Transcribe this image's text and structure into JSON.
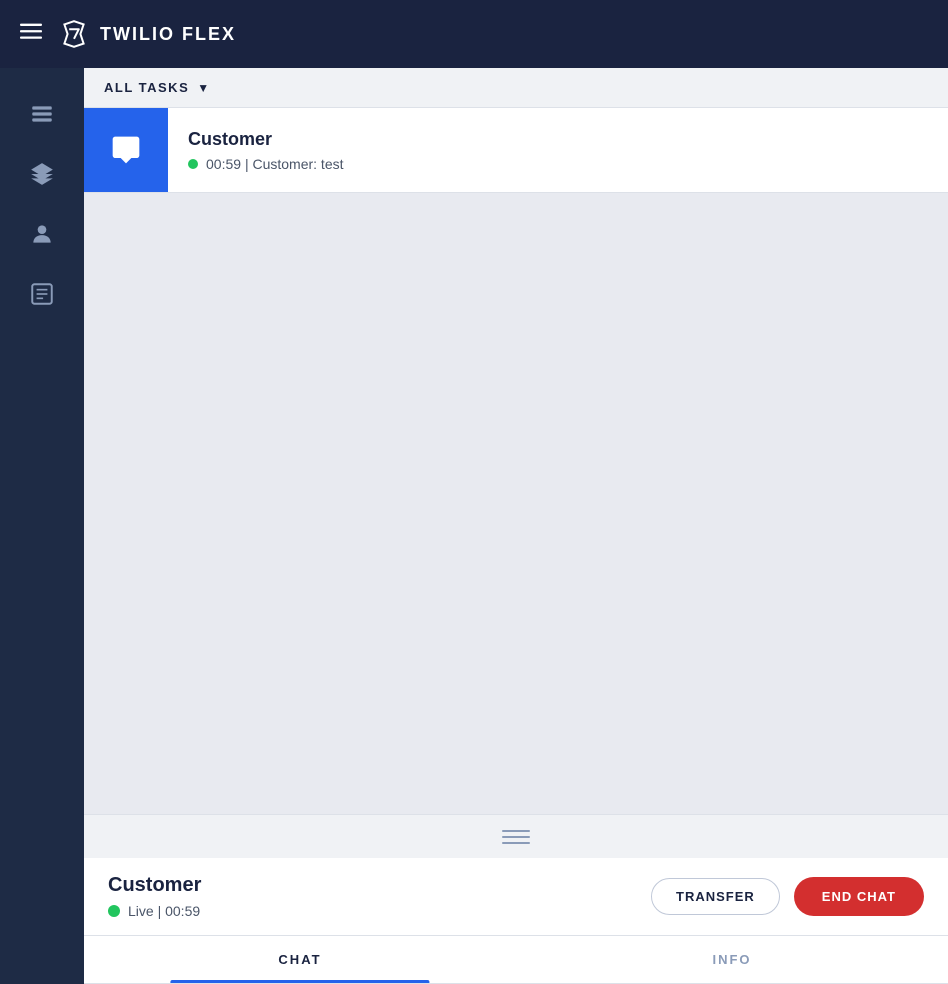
{
  "header": {
    "menu_icon": "☰",
    "app_title": "TWILIO FLEX"
  },
  "sidebar": {
    "items": [
      {
        "name": "tasks-icon",
        "label": "Tasks"
      },
      {
        "name": "layers-icon",
        "label": "Layers"
      },
      {
        "name": "agent-icon",
        "label": "Agent"
      },
      {
        "name": "contacts-icon",
        "label": "Contacts"
      }
    ]
  },
  "tasks": {
    "header_label": "ALL TASKS",
    "task": {
      "customer_name": "Customer",
      "timer": "00:59",
      "separator": "|",
      "channel": "Customer: test"
    }
  },
  "customer_panel": {
    "name": "Customer",
    "live_label": "Live",
    "timer": "00:59",
    "transfer_button": "TRANSFER",
    "end_chat_button": "END CHAT"
  },
  "tabs": [
    {
      "id": "chat",
      "label": "CHAT",
      "active": true
    },
    {
      "id": "info",
      "label": "INFO",
      "active": false
    }
  ],
  "colors": {
    "header_bg": "#1a2340",
    "sidebar_bg": "#1e2b45",
    "task_icon_bg": "#2563eb",
    "live_green": "#22c55e",
    "end_chat_red": "#d32f2f",
    "tab_active_blue": "#2563eb"
  }
}
